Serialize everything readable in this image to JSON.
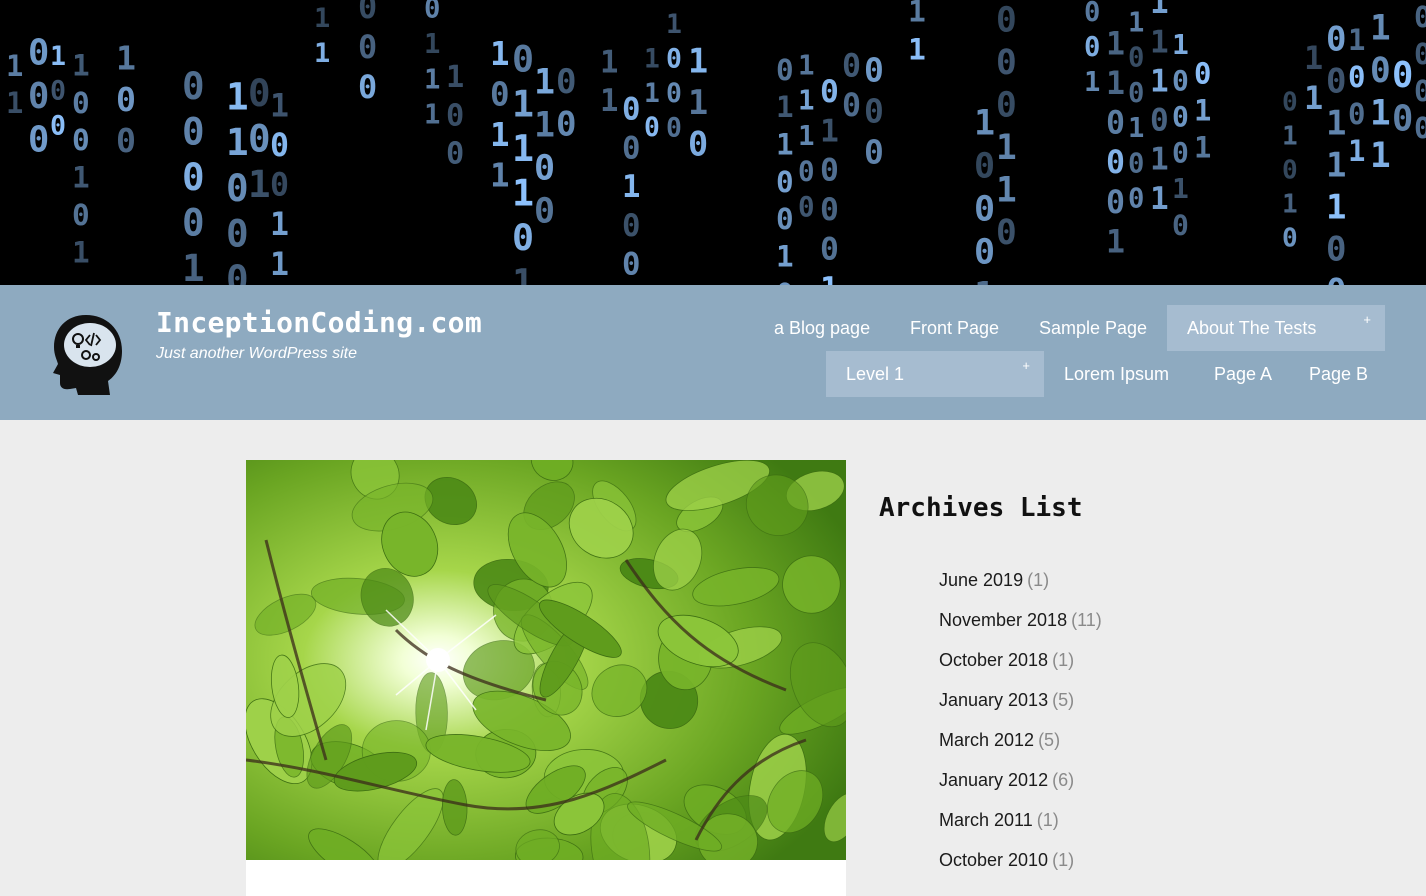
{
  "site": {
    "title": "InceptionCoding.com",
    "tagline": "Just another WordPress site"
  },
  "nav": {
    "items": [
      {
        "label": "a Blog page"
      },
      {
        "label": "Front Page"
      },
      {
        "label": "Sample Page"
      },
      {
        "label": "About The Tests",
        "submenu_indicator": "+"
      },
      {
        "label": "Level 1",
        "submenu_indicator": "+"
      },
      {
        "label": "Lorem Ipsum"
      },
      {
        "label": "Page A"
      },
      {
        "label": "Page B"
      }
    ]
  },
  "sidebar": {
    "widget_title": "Archives List",
    "archives": [
      {
        "month": "June 2019",
        "count": "(1)"
      },
      {
        "month": "November 2018",
        "count": "(11)"
      },
      {
        "month": "October 2018",
        "count": "(1)"
      },
      {
        "month": "January 2013",
        "count": "(5)"
      },
      {
        "month": "March 2012",
        "count": "(5)"
      },
      {
        "month": "January 2012",
        "count": "(6)"
      },
      {
        "month": "March 2011",
        "count": "(1)"
      },
      {
        "month": "October 2010",
        "count": "(1)"
      }
    ]
  },
  "colors": {
    "header_bar": "#8eaac0",
    "nav_highlight": "#a6bcd0",
    "page_background": "#ededed",
    "binary_glyph": "#8fc4ff"
  },
  "icons": {
    "logo": "head-with-lightbulb-gears-code-icon"
  }
}
